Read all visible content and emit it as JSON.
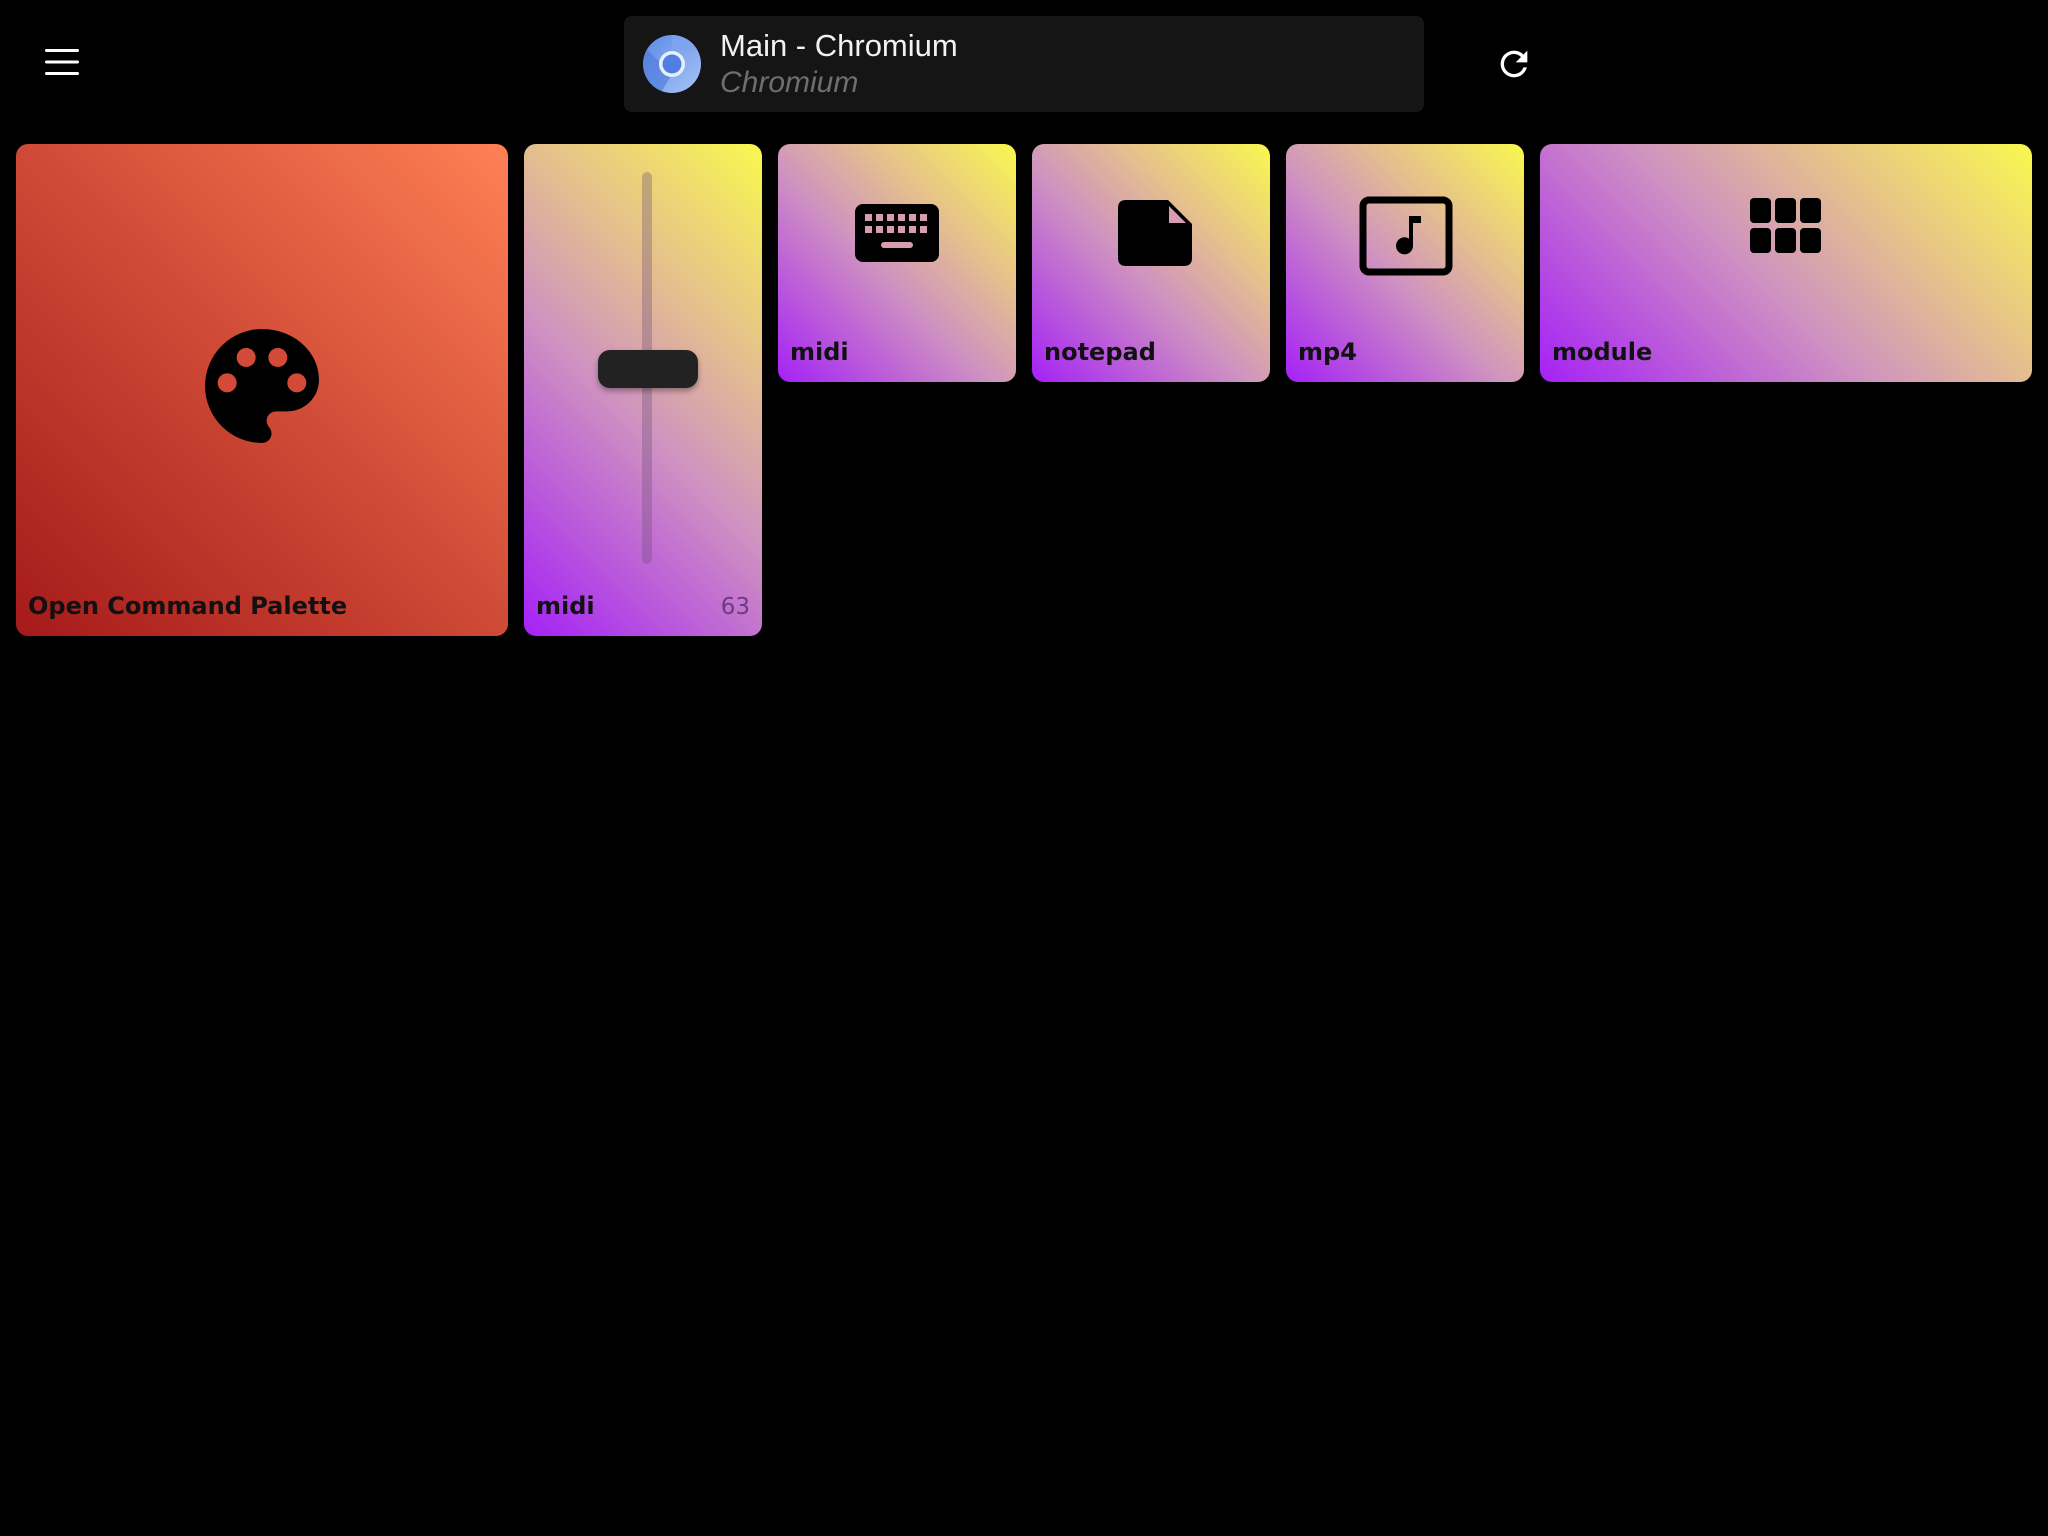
{
  "header": {
    "window_title": "Main - Chromium",
    "window_subtitle": "Chromium",
    "menu_icon": "hamburger-menu-icon",
    "refresh_icon": "refresh-icon",
    "app_icon": "chromium-icon"
  },
  "tiles": [
    {
      "label": "Open Command Palette",
      "icon": "palette-icon",
      "color_from": "#a51a1a",
      "color_to": "#ff8055"
    },
    {
      "label": "midi",
      "type": "slider",
      "value": 63,
      "value_display": "63",
      "level_fraction": 0.5
    },
    {
      "label": "midi",
      "icon": "keyboard-icon"
    },
    {
      "label": "notepad",
      "icon": "file-icon"
    },
    {
      "label": "mp4",
      "icon": "music-video-icon"
    },
    {
      "label": "module",
      "icon": "grid-icon"
    }
  ],
  "colors": {
    "background": "#000000",
    "gradient_yellow": "#f9f84f",
    "gradient_purple": "#a521f6",
    "selector_bg": "#151515"
  }
}
